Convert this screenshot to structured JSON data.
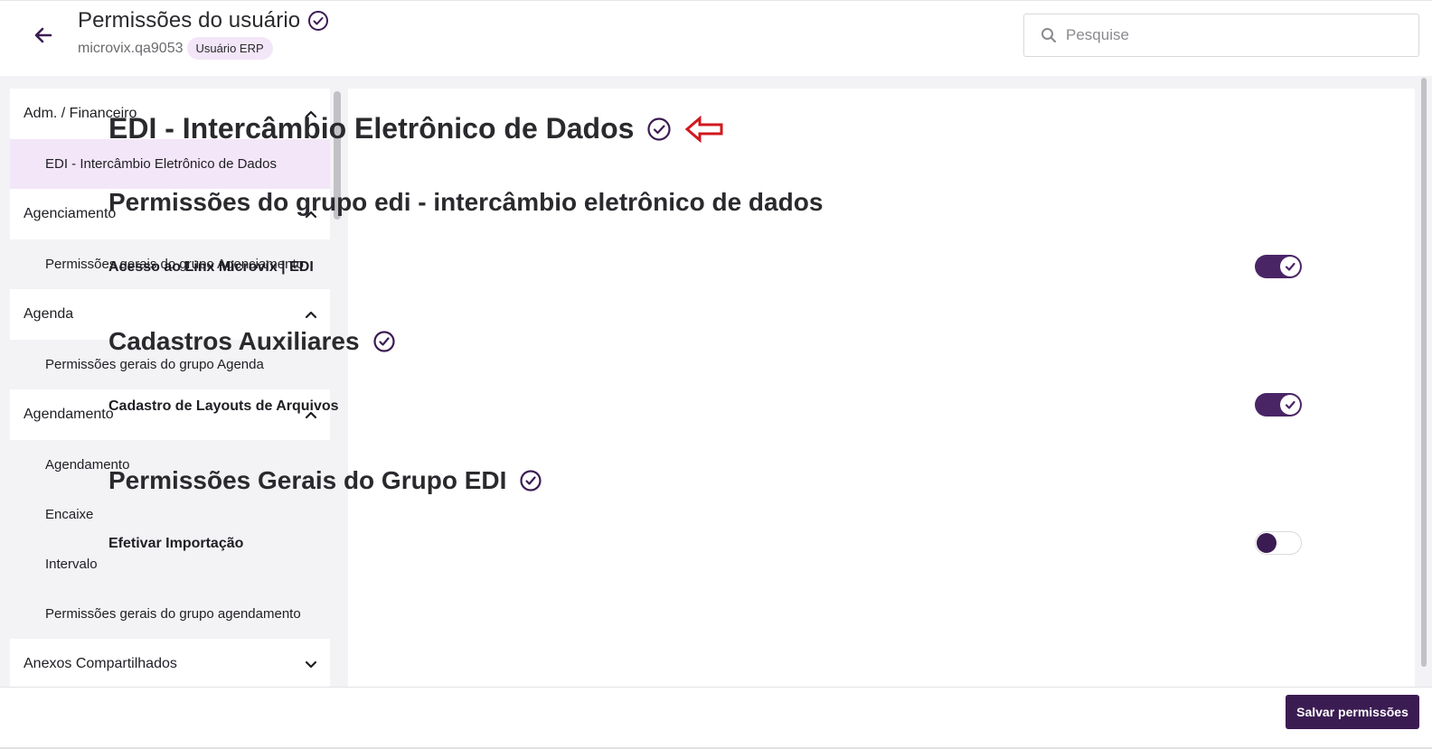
{
  "header": {
    "title": "Permissões do usuário",
    "username": "microvix.qa9053",
    "badge": "Usuário ERP"
  },
  "search": {
    "placeholder": "Pesquise"
  },
  "sidebar": {
    "groups": [
      {
        "label": "Adm. / Financeiro",
        "expanded": true,
        "items": [
          {
            "label": "EDI - Intercâmbio Eletrônico de Dados",
            "active": true
          }
        ]
      },
      {
        "label": "Agenciamento",
        "expanded": true,
        "items": [
          {
            "label": "Permissões gerais do grupo Agenciamento",
            "active": false
          }
        ]
      },
      {
        "label": "Agenda",
        "expanded": true,
        "items": [
          {
            "label": "Permissões gerais do grupo Agenda",
            "active": false
          }
        ]
      },
      {
        "label": "Agendamento",
        "expanded": true,
        "items": [
          {
            "label": "Agendamento",
            "active": false
          },
          {
            "label": "Encaixe",
            "active": false
          },
          {
            "label": "Intervalo",
            "active": false
          },
          {
            "label": "Permissões gerais do grupo agendamento",
            "active": false
          }
        ]
      },
      {
        "label": "Anexos Compartilhados",
        "expanded": false,
        "items": []
      }
    ]
  },
  "main": {
    "title": "EDI - Intercâmbio Eletrônico de Dados",
    "group_title": "Permissões do grupo edi - intercâmbio eletrônico de dados",
    "access_label": "Acesso ao Linx Microvix | EDI",
    "access_enabled": true,
    "sections": [
      {
        "title": "Cadastros Auxiliares",
        "permissions": [
          {
            "label": "Cadastro de Layouts de Arquivos",
            "enabled": true
          }
        ]
      },
      {
        "title": "Permissões Gerais do Grupo EDI",
        "permissions": [
          {
            "label": "Efetivar Importação",
            "enabled": false
          }
        ]
      }
    ]
  },
  "footer": {
    "save_label": "Salvar permissões"
  },
  "colors": {
    "primary": "#3b1c52",
    "toggle_on": "#4a2566",
    "highlight": "#f3e6f8",
    "annotation_arrow": "#d0181e"
  },
  "icons": [
    "back-arrow-icon",
    "check-circle-icon",
    "search-icon",
    "chevron-up-icon",
    "chevron-down-icon",
    "red-arrow-icon",
    "checkmark-icon"
  ]
}
